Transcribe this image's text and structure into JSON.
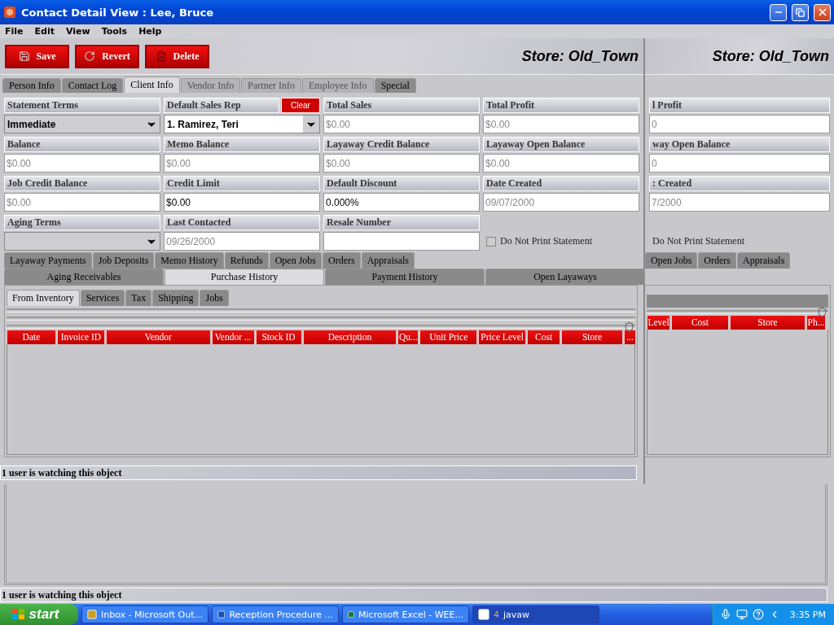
{
  "window": {
    "title": "Contact Detail View : Lee, Bruce"
  },
  "menu": [
    "File",
    "Edit",
    "View",
    "Tools",
    "Help"
  ],
  "toolbar": {
    "buttons": [
      {
        "label": "Save",
        "kind": "save"
      },
      {
        "label": "Revert",
        "kind": "revert"
      },
      {
        "label": "Delete",
        "kind": "delete"
      }
    ],
    "store": "Store: Old_Town"
  },
  "tabs": [
    {
      "label": "Person Info",
      "selected": false,
      "disabled": false
    },
    {
      "label": "Contact Log",
      "selected": false,
      "disabled": false
    },
    {
      "label": "Client Info",
      "selected": true,
      "disabled": false
    },
    {
      "label": "Vendor Info",
      "selected": false,
      "disabled": true
    },
    {
      "label": "Partner Info",
      "selected": false,
      "disabled": true
    },
    {
      "label": "Employee Info",
      "selected": false,
      "disabled": true
    },
    {
      "label": "Special",
      "selected": false,
      "disabled": false
    }
  ],
  "fields": [
    {
      "label": "Statement Terms",
      "kind": "dropdown",
      "value": "Immediate",
      "editable": false
    },
    {
      "label": "Default Sales Rep",
      "kind": "dropdown",
      "value": "1. Ramirez, Teri",
      "editable": true,
      "clear": "Clear"
    },
    {
      "label": "Total Sales",
      "kind": "text",
      "value": "$0.00",
      "readonly": true
    },
    {
      "label": "Total Profit",
      "kind": "text",
      "value": "$0.00",
      "readonly": true
    },
    {
      "label": "Balance",
      "kind": "text",
      "value": "$0.00",
      "readonly": true
    },
    {
      "label": "Memo Balance",
      "kind": "text",
      "value": "$0.00",
      "readonly": true
    },
    {
      "label": "Layaway Credit Balance",
      "kind": "text",
      "value": "$0.00",
      "readonly": true
    },
    {
      "label": "Layaway Open Balance",
      "kind": "text",
      "value": "$0.00",
      "readonly": true
    },
    {
      "label": "Job Credit Balance",
      "kind": "text",
      "value": "$0.00",
      "readonly": true
    },
    {
      "label": "Credit Limit",
      "kind": "text",
      "value": "$0.00",
      "readonly": false
    },
    {
      "label": "Default Discount",
      "kind": "text",
      "value": "0.000%",
      "readonly": false
    },
    {
      "label": "Date Created",
      "kind": "text",
      "value": "09/07/2000",
      "readonly": true
    },
    {
      "label": "Aging Terms",
      "kind": "dropdown",
      "editable": false
    },
    {
      "label": "Last Contacted",
      "kind": "text",
      "value": "09/26/2000",
      "readonly": true
    },
    {
      "label": "Resale Number",
      "kind": "text"
    },
    {
      "label": "Do Not Print Statement",
      "kind": "checkbox",
      "checked": false
    }
  ],
  "history_tabs": [
    {
      "label": "Layaway Payments",
      "selected": false
    },
    {
      "label": "Job Deposits",
      "selected": false
    },
    {
      "label": "Memo History",
      "selected": false
    },
    {
      "label": "Refunds",
      "selected": false
    },
    {
      "label": "Open Jobs",
      "selected": false
    },
    {
      "label": "Orders",
      "selected": false
    },
    {
      "label": "Appraisals",
      "selected": false
    }
  ],
  "history_tabs_2": [
    {
      "label": "Aging Receivables",
      "selected": false
    },
    {
      "label": "Purchase History",
      "selected": true
    },
    {
      "label": "Payment History",
      "selected": false
    },
    {
      "label": "Open Layaways",
      "selected": false
    }
  ],
  "purchase_tabs": [
    {
      "label": "From Inventory",
      "selected": true
    },
    {
      "label": "Services",
      "selected": false
    },
    {
      "label": "Tax",
      "selected": false
    },
    {
      "label": "Shipping",
      "selected": false
    },
    {
      "label": "Jobs",
      "selected": false
    }
  ],
  "table": {
    "columns": [
      "Date",
      "Invoice ID",
      "Vendor",
      "Vendor ...",
      "Stock ID",
      "Description",
      "Qu...",
      "Unit Price",
      "Price Level",
      "Cost",
      "Store",
      "..."
    ]
  },
  "status": "1 user is watching this object",
  "ghost": {
    "store": "Store: Old_Town",
    "fields": [
      {
        "label": "l Profit",
        "value": "0"
      },
      {
        "label": "way Open Balance",
        "value": "0"
      },
      {
        "label": ": Created",
        "value": "7/2000"
      }
    ],
    "checkbox_label": "Do Not Print Statement",
    "tabs": [
      "Open Jobs",
      "Orders",
      "Appraisals"
    ],
    "columns": [
      "Level",
      "Cost",
      "Store",
      "Ph..."
    ],
    "status": "1 user is watching this object"
  },
  "taskbar": {
    "start": "start",
    "items": [
      {
        "label": "Inbox - Microsoft Out...",
        "kind": "outlook",
        "selected": false
      },
      {
        "label": "Reception Procedure ...",
        "kind": "word",
        "selected": false
      },
      {
        "label": "Microsoft Excel - WEE...",
        "kind": "excel",
        "selected": false
      },
      {
        "label": "javaw",
        "count": "4",
        "kind": "java",
        "selected": true
      }
    ],
    "clock": "3:35 PM"
  }
}
